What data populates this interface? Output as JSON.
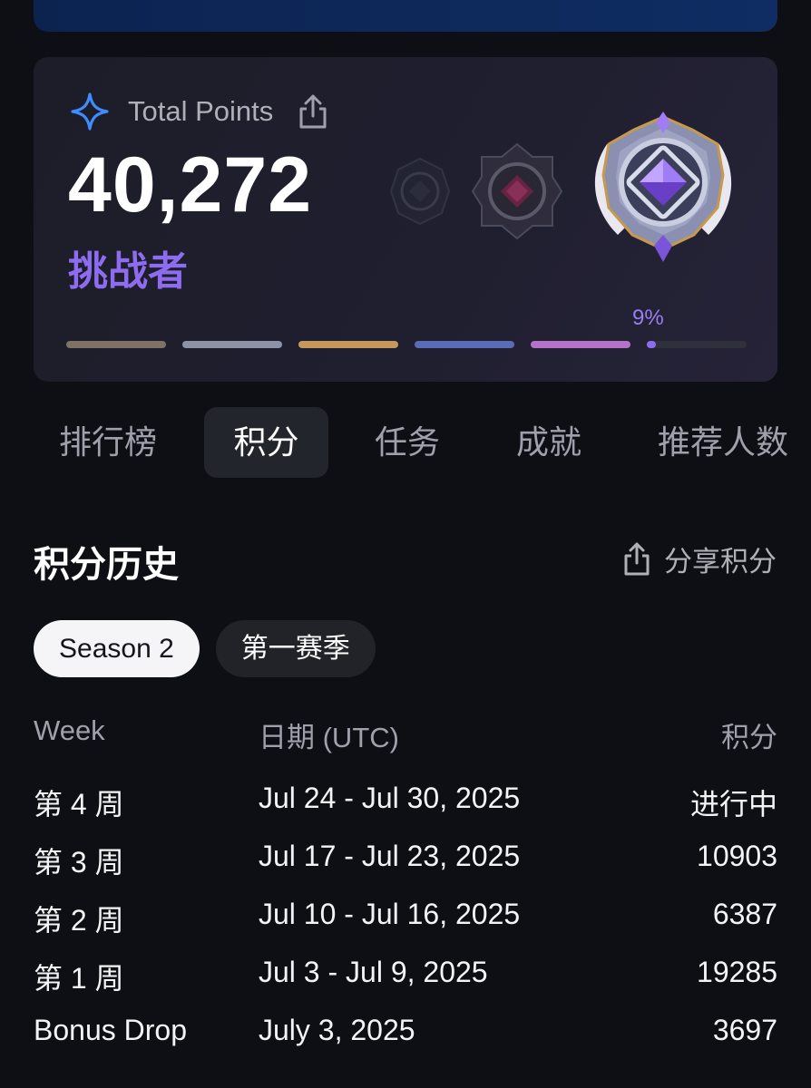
{
  "points_card": {
    "label": "Total Points",
    "points": "40,272",
    "rank": "挑战者",
    "progress_percent_label": "9%",
    "progress_fraction": 0.09,
    "tier_colors": [
      "#7d7264",
      "#8d93a6",
      "#c6975a",
      "#5a6bb7",
      "#b572c8"
    ]
  },
  "tabs": [
    {
      "label": "排行榜",
      "active": false
    },
    {
      "label": "积分",
      "active": true
    },
    {
      "label": "任务",
      "active": false
    },
    {
      "label": "成就",
      "active": false
    },
    {
      "label": "推荐人数",
      "active": false
    }
  ],
  "history": {
    "title": "积分历史",
    "share_label": "分享积分",
    "seasons": [
      {
        "label": "Season 2",
        "active": true
      },
      {
        "label": "第一赛季",
        "active": false
      }
    ],
    "columns": {
      "week": "Week",
      "date": "日期 (UTC)",
      "points": "积分"
    },
    "rows": [
      {
        "week": "第 4 周",
        "date": "Jul 24 - Jul 30, 2025",
        "points": "进行中"
      },
      {
        "week": "第 3 周",
        "date": "Jul 17 - Jul 23, 2025",
        "points": "10903"
      },
      {
        "week": "第 2 周",
        "date": "Jul 10 - Jul 16, 2025",
        "points": "6387"
      },
      {
        "week": "第 1 周",
        "date": "Jul 3 - Jul 9, 2025",
        "points": "19285"
      },
      {
        "week": "Bonus Drop",
        "date": "July 3, 2025",
        "points": "3697"
      }
    ]
  }
}
